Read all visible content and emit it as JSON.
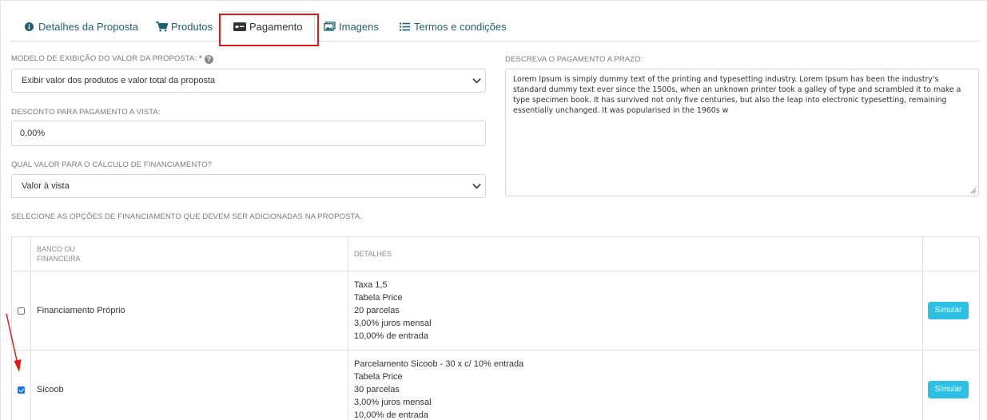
{
  "tabs": [
    {
      "label": "Detalhes da Proposta",
      "icon": "info-circle-icon"
    },
    {
      "label": "Produtos",
      "icon": "shopping-cart-icon"
    },
    {
      "label": "Pagamento",
      "icon": "money-bill-icon"
    },
    {
      "label": "Imagens",
      "icon": "image-icon"
    },
    {
      "label": "Termos e condições",
      "icon": "list-icon"
    }
  ],
  "active_tab": "Pagamento",
  "form": {
    "display_model_label": "MODELO DE EXIBIÇÃO DO VALOR DA PROPOSTA:",
    "required_mark": "*",
    "display_model_value": "Exibir valor dos produtos e valor total da proposta",
    "discount_label": "DESCONTO PARA PAGAMENTO A VISTA:",
    "discount_value": "0,00%",
    "financing_value_label": "QUAL VALOR PARA O CÁLCULO DE FINANCIAMENTO?",
    "financing_value_value": "Valor à vista",
    "term_payment_label": "DESCREVA O PAGAMENTO A PRAZO:",
    "term_payment_text": "Lorem Ipsum is simply dummy text of the printing and typesetting industry. Lorem Ipsum has been the industry's standard dummy text ever since the 1500s, when an unknown printer took a galley of type and scrambled it to make a type specimen book. It has survived not only five centuries, but also the leap into electronic typesetting, remaining essentially unchanged. It was popularised in the 1960s w",
    "financing_options_label": "SELECIONE AS OPÇÕES DE FINANCIAMENTO QUE DEVEM SER ADICIONADAS NA PROPOSTA."
  },
  "table": {
    "headers": [
      "BANCO OU FINANCEIRA",
      "DETALHES"
    ],
    "rows": [
      {
        "checked": false,
        "bank": "Financiamento Próprio",
        "details": [
          "Taxa 1,5",
          "Tabela Price",
          "20 parcelas",
          "3,00% juros mensal",
          "10,00% de entrada"
        ],
        "button": "Simular"
      },
      {
        "checked": true,
        "bank": "Sicoob",
        "details": [
          "Parcelamento Sicoob - 30 x c/ 10% entrada",
          "Tabela Price",
          "30 parcelas",
          "3,00% juros mensal",
          "10,00% de entrada"
        ],
        "button": "Simular"
      }
    ]
  },
  "colors": {
    "accent": "#2bc0e4",
    "tab_text": "#1f5f74",
    "highlight": "#e01818"
  }
}
